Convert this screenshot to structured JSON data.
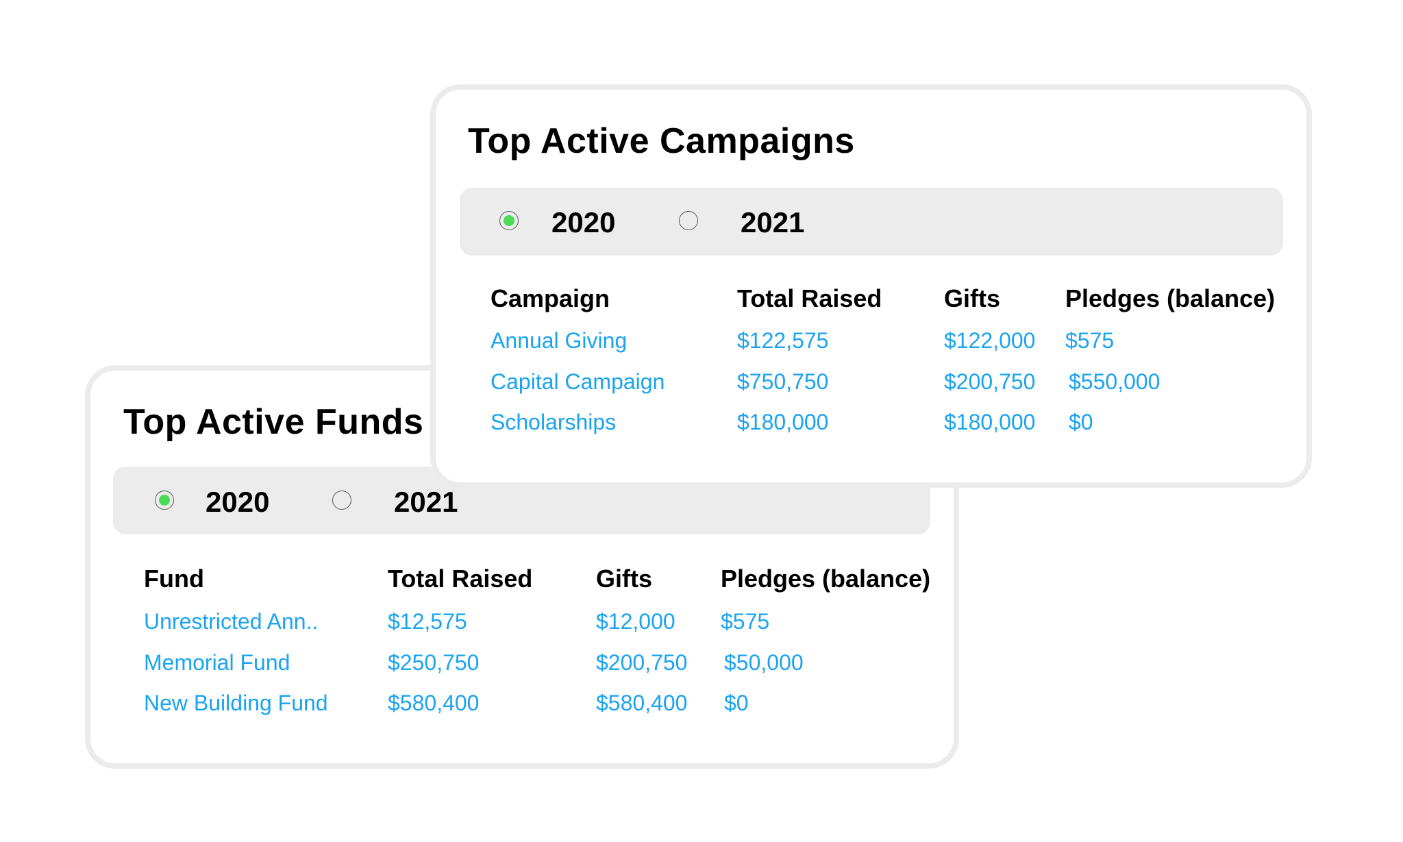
{
  "colors": {
    "link": "#1aa3f0",
    "radio_selected": "#4cdb55",
    "bar_bg": "#ececec",
    "card_border": "#ebebeb"
  },
  "campaigns": {
    "title": "Top Active Campaigns",
    "years": [
      {
        "label": "2020",
        "selected": true
      },
      {
        "label": "2021",
        "selected": false
      }
    ],
    "columns": [
      "Campaign",
      "Total Raised",
      "Gifts",
      "Pledges (balance)"
    ],
    "rows": [
      [
        "Annual Giving",
        "$122,575",
        "$122,000",
        "$575"
      ],
      [
        "Capital Campaign",
        "$750,750",
        "$200,750",
        "$550,000"
      ],
      [
        "Scholarships",
        "$180,000",
        "$180,000",
        "$0"
      ]
    ]
  },
  "funds": {
    "title": "Top Active Funds",
    "years": [
      {
        "label": "2020",
        "selected": true
      },
      {
        "label": "2021",
        "selected": false
      }
    ],
    "columns": [
      "Fund",
      "Total Raised",
      "Gifts",
      "Pledges (balance)"
    ],
    "rows": [
      [
        "Unrestricted Ann..",
        "$12,575",
        "$12,000",
        "$575"
      ],
      [
        "Memorial Fund",
        "$250,750",
        "$200,750",
        "$50,000"
      ],
      [
        "New Building Fund",
        "$580,400",
        "$580,400",
        "$0"
      ]
    ]
  }
}
